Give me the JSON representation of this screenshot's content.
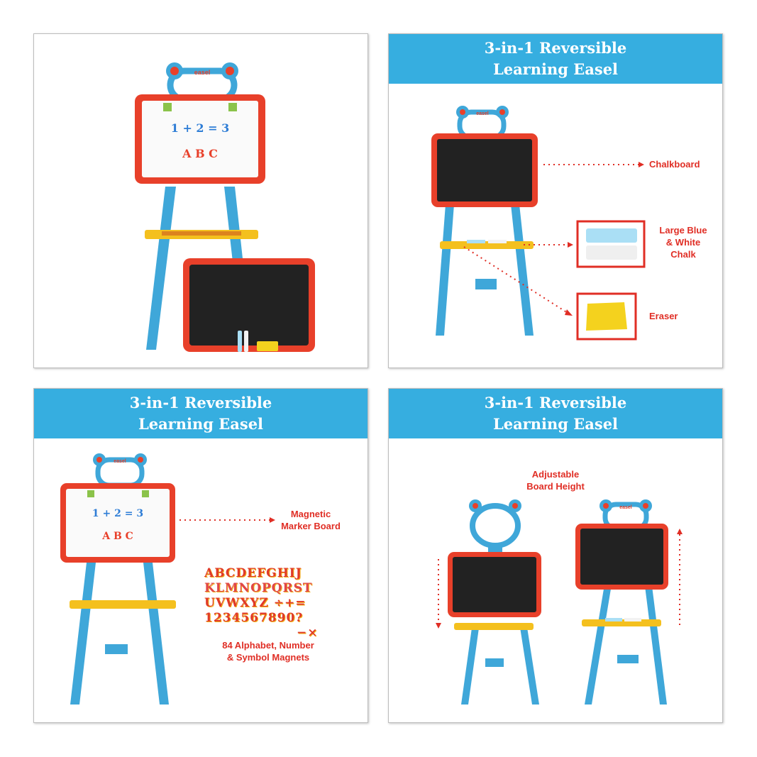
{
  "colors": {
    "accent": "#36aee0",
    "label": "#e02e25",
    "frame": "#e8402a",
    "leg": "#3fa7d9",
    "tray": "#f4c01e"
  },
  "easel": {
    "logo": "easel"
  },
  "panel1": {
    "whiteboard_math": "1 + 2 = 3",
    "whiteboard_letters": "A B C"
  },
  "panel2": {
    "title_line1": "3-in-1 Reversible",
    "title_line2": "Learning Easel",
    "label_chalkboard": "Chalkboard",
    "label_chalk_line1": "Large Blue",
    "label_chalk_line2": "& White",
    "label_chalk_line3": "Chalk",
    "label_eraser": "Eraser"
  },
  "panel3": {
    "title_line1": "3-in-1 Reversible",
    "title_line2": "Learning Easel",
    "label_board_line1": "Magnetic",
    "label_board_line2": "Marker Board",
    "whiteboard_math": "1 + 2 = 3",
    "whiteboard_letters": "A B C",
    "magnets_row1": "ABCDEFGHIJ",
    "magnets_row2": "KLMNOPQRST",
    "magnets_row3": "UVWXYZ ÷+=",
    "magnets_row4": "1234567890?",
    "magnets_row5": "−×",
    "label_magnets_line1": "84 Alphabet, Number",
    "label_magnets_line2": "& Symbol Magnets"
  },
  "panel4": {
    "title_line1": "3-in-1 Reversible",
    "title_line2": "Learning Easel",
    "label_height_line1": "Adjustable",
    "label_height_line2": "Board Height"
  }
}
